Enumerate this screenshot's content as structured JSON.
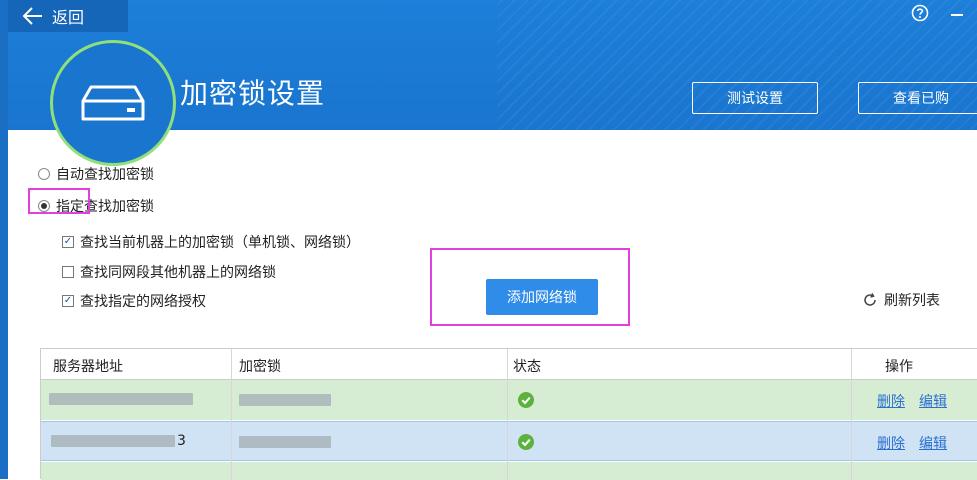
{
  "nav": {
    "back_label": "返回"
  },
  "header": {
    "title": "加密锁设置",
    "test_button": "测试设置",
    "view_button": "查看已购"
  },
  "options": {
    "radio_auto": "自动查找加密锁",
    "radio_specified": "指定查找加密锁",
    "check_current": "查找当前机器上的加密锁（单机锁、网络锁）",
    "check_same_segment": "查找同网段其他机器上的网络锁",
    "check_specified_license": "查找指定的网络授权"
  },
  "actions": {
    "add_network_lock": "添加网络锁",
    "refresh_list": "刷新列表"
  },
  "table": {
    "headers": [
      "服务器地址",
      "加密锁",
      "状态",
      "操作"
    ],
    "rows": [
      {
        "server_tail": "",
        "delete": "删除",
        "edit": "编辑"
      },
      {
        "server_tail": "3",
        "delete": "删除",
        "edit": "编辑"
      }
    ]
  },
  "colors": {
    "header_blue": "#1a75cf",
    "accent_button": "#2f8ce8",
    "ring_green": "#8fe07a",
    "highlight_magenta": "#e040e0",
    "row_green": "#d7edd3",
    "row_blue": "#cfe3f5",
    "ok_green": "#5cb23e"
  }
}
